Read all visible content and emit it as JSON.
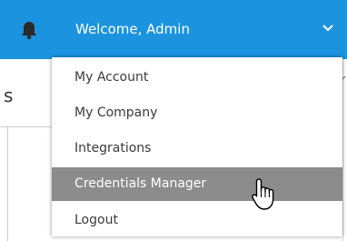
{
  "header": {
    "notification_icon": "bell-icon",
    "welcome_text": "Welcome,  Admin",
    "dropdown_icon": "chevron-down-icon",
    "background_color": "#1b93df"
  },
  "background": {
    "partial_heading_letter": "s"
  },
  "user_menu": {
    "items": [
      {
        "label": "My Account",
        "active": false
      },
      {
        "label": "My Company",
        "active": false
      },
      {
        "label": "Integrations",
        "active": false
      },
      {
        "label": "Credentials Manager",
        "active": true
      },
      {
        "label": "Logout",
        "active": false
      }
    ],
    "active_background": "#8c8c8c"
  },
  "pointer": {
    "icon": "hand-pointer-icon"
  }
}
